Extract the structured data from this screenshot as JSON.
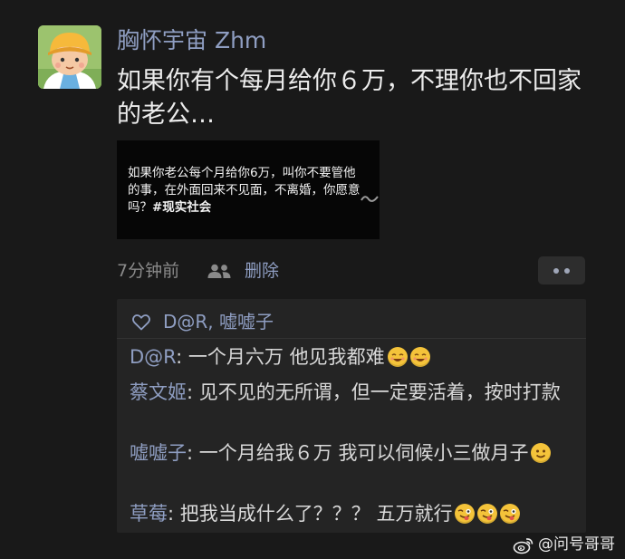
{
  "post": {
    "username": "胸怀宇宙 Zhm",
    "text": "如果你有个每月给你６万，不理你也不回家的老公…",
    "image_text": "如果你老公每个月给你6万，叫你不要管他的事，在外面回来不见面，不离婚，你愿意吗？",
    "image_tag": "#现实社会",
    "time": "7分钟前",
    "delete_label": "删除"
  },
  "likes": {
    "names": "D@R, 嘘嘘子"
  },
  "comments": [
    {
      "author": "D@R",
      "separator": ": ",
      "text": "一个月六万 他见我都难",
      "emoji": [
        "grin-face-icon",
        "grin-face-icon"
      ]
    },
    {
      "author": "蔡文姬",
      "separator": ": ",
      "text": "见不见的无所谓，但一定要活着，按时打款",
      "emoji": []
    },
    {
      "author": "嘘嘘子",
      "separator": ": ",
      "text": "一个月给我６万 我可以伺候小三做月子",
      "emoji": [
        "smile-face-icon"
      ]
    },
    {
      "author": "草莓",
      "separator": ": ",
      "text": "把我当成什么了？？？ 五万就行",
      "emoji": [
        "wink-tongue-face-icon",
        "wink-tongue-face-icon",
        "wink-tongue-face-icon"
      ]
    }
  ],
  "watermark": {
    "text": "@问号哥哥"
  },
  "colors": {
    "background": "#191919",
    "link_blue": "#8f9ec2",
    "comment_panel": "#242424",
    "emoji_yellow": "#f4c33a"
  }
}
